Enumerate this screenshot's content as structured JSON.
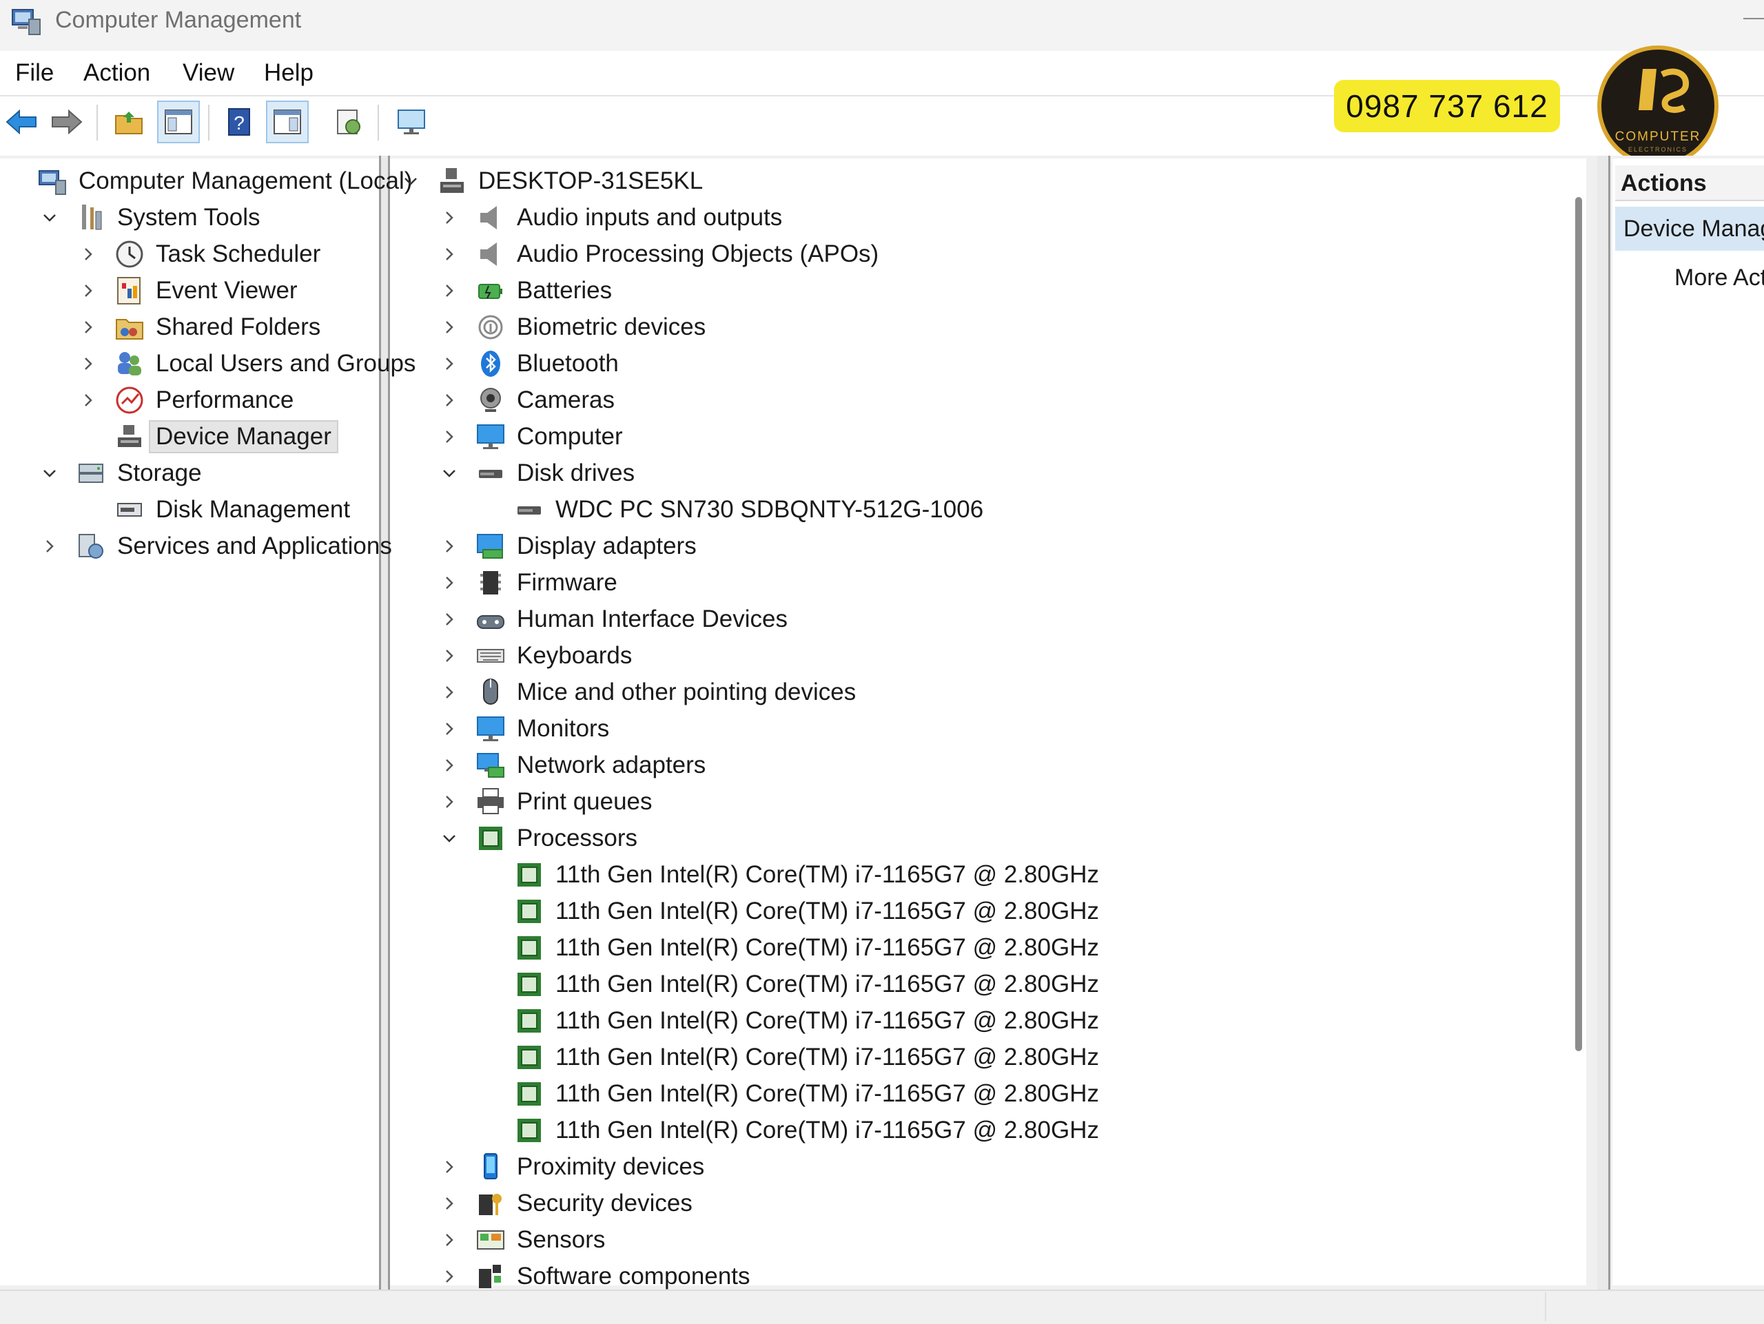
{
  "window": {
    "title": "Computer Management"
  },
  "menu": [
    "File",
    "Action",
    "View",
    "Help"
  ],
  "toolbar": {
    "icons": [
      "back-arrow-icon",
      "forward-arrow-icon",
      "up-folder-icon",
      "show-hide-tree-icon",
      "help-icon",
      "show-hide-action-pane-icon",
      "properties-icon",
      "monitor-icon"
    ]
  },
  "overlay": {
    "phone": "0987 737 612",
    "logo_text": "COMPUTER",
    "logo_sub": "ELECTRONICS"
  },
  "left_tree": [
    {
      "label": "Computer Management (Local)",
      "icon": "computer-management-icon",
      "level": 0,
      "chevron": "none"
    },
    {
      "label": "System Tools",
      "icon": "system-tools-icon",
      "level": 1,
      "chevron": "down"
    },
    {
      "label": "Task Scheduler",
      "icon": "clock-icon",
      "level": 2,
      "chevron": "right"
    },
    {
      "label": "Event Viewer",
      "icon": "event-viewer-icon",
      "level": 2,
      "chevron": "right"
    },
    {
      "label": "Shared Folders",
      "icon": "shared-folder-icon",
      "level": 2,
      "chevron": "right"
    },
    {
      "label": "Local Users and Groups",
      "icon": "users-icon",
      "level": 2,
      "chevron": "right"
    },
    {
      "label": "Performance",
      "icon": "performance-icon",
      "level": 2,
      "chevron": "right"
    },
    {
      "label": "Device Manager",
      "icon": "device-manager-icon",
      "level": 2,
      "chevron": "none",
      "selected": true
    },
    {
      "label": "Storage",
      "icon": "storage-icon",
      "level": 1,
      "chevron": "down"
    },
    {
      "label": "Disk Management",
      "icon": "disk-management-icon",
      "level": 2,
      "chevron": "none"
    },
    {
      "label": "Services and Applications",
      "icon": "services-icon",
      "level": 1,
      "chevron": "right"
    }
  ],
  "device_tree": [
    {
      "label": "DESKTOP-31SE5KL",
      "icon": "computer-root-icon",
      "level": 0,
      "chevron": "down"
    },
    {
      "label": "Audio inputs and outputs",
      "icon": "speaker-icon",
      "level": 1,
      "chevron": "right"
    },
    {
      "label": "Audio Processing Objects (APOs)",
      "icon": "speaker-icon",
      "level": 1,
      "chevron": "right"
    },
    {
      "label": "Batteries",
      "icon": "battery-icon",
      "level": 1,
      "chevron": "right"
    },
    {
      "label": "Biometric devices",
      "icon": "fingerprint-icon",
      "level": 1,
      "chevron": "right"
    },
    {
      "label": "Bluetooth",
      "icon": "bluetooth-icon",
      "level": 1,
      "chevron": "right"
    },
    {
      "label": "Cameras",
      "icon": "camera-icon",
      "level": 1,
      "chevron": "right"
    },
    {
      "label": "Computer",
      "icon": "monitor-icon",
      "level": 1,
      "chevron": "right"
    },
    {
      "label": "Disk drives",
      "icon": "disk-drive-icon",
      "level": 1,
      "chevron": "down"
    },
    {
      "label": "WDC PC SN730 SDBQNTY-512G-1006",
      "icon": "disk-drive-icon",
      "level": 2,
      "chevron": "none"
    },
    {
      "label": "Display adapters",
      "icon": "display-adapter-icon",
      "level": 1,
      "chevron": "right"
    },
    {
      "label": "Firmware",
      "icon": "firmware-icon",
      "level": 1,
      "chevron": "right"
    },
    {
      "label": "Human Interface Devices",
      "icon": "hid-icon",
      "level": 1,
      "chevron": "right"
    },
    {
      "label": "Keyboards",
      "icon": "keyboard-icon",
      "level": 1,
      "chevron": "right"
    },
    {
      "label": "Mice and other pointing devices",
      "icon": "mouse-icon",
      "level": 1,
      "chevron": "right"
    },
    {
      "label": "Monitors",
      "icon": "monitor-icon",
      "level": 1,
      "chevron": "right"
    },
    {
      "label": "Network adapters",
      "icon": "network-adapter-icon",
      "level": 1,
      "chevron": "right"
    },
    {
      "label": "Print queues",
      "icon": "printer-icon",
      "level": 1,
      "chevron": "right"
    },
    {
      "label": "Processors",
      "icon": "processor-icon",
      "level": 1,
      "chevron": "down"
    },
    {
      "label": "11th Gen Intel(R) Core(TM) i7-1165G7 @ 2.80GHz",
      "icon": "processor-icon",
      "level": 2,
      "chevron": "none"
    },
    {
      "label": "11th Gen Intel(R) Core(TM) i7-1165G7 @ 2.80GHz",
      "icon": "processor-icon",
      "level": 2,
      "chevron": "none"
    },
    {
      "label": "11th Gen Intel(R) Core(TM) i7-1165G7 @ 2.80GHz",
      "icon": "processor-icon",
      "level": 2,
      "chevron": "none"
    },
    {
      "label": "11th Gen Intel(R) Core(TM) i7-1165G7 @ 2.80GHz",
      "icon": "processor-icon",
      "level": 2,
      "chevron": "none"
    },
    {
      "label": "11th Gen Intel(R) Core(TM) i7-1165G7 @ 2.80GHz",
      "icon": "processor-icon",
      "level": 2,
      "chevron": "none"
    },
    {
      "label": "11th Gen Intel(R) Core(TM) i7-1165G7 @ 2.80GHz",
      "icon": "processor-icon",
      "level": 2,
      "chevron": "none"
    },
    {
      "label": "11th Gen Intel(R) Core(TM) i7-1165G7 @ 2.80GHz",
      "icon": "processor-icon",
      "level": 2,
      "chevron": "none"
    },
    {
      "label": "11th Gen Intel(R) Core(TM) i7-1165G7 @ 2.80GHz",
      "icon": "processor-icon",
      "level": 2,
      "chevron": "none"
    },
    {
      "label": "Proximity devices",
      "icon": "proximity-icon",
      "level": 1,
      "chevron": "right"
    },
    {
      "label": "Security devices",
      "icon": "security-icon",
      "level": 1,
      "chevron": "right"
    },
    {
      "label": "Sensors",
      "icon": "sensor-icon",
      "level": 1,
      "chevron": "right"
    },
    {
      "label": "Software components",
      "icon": "software-component-icon",
      "level": 1,
      "chevron": "right"
    }
  ],
  "actions": {
    "header": "Actions",
    "selected_item": "Device Manager",
    "more": "More Actions"
  },
  "colors": {
    "accent": "#d6e6f5",
    "processor_green": "#2e7d32",
    "badge_yellow": "#f6ea2c"
  }
}
